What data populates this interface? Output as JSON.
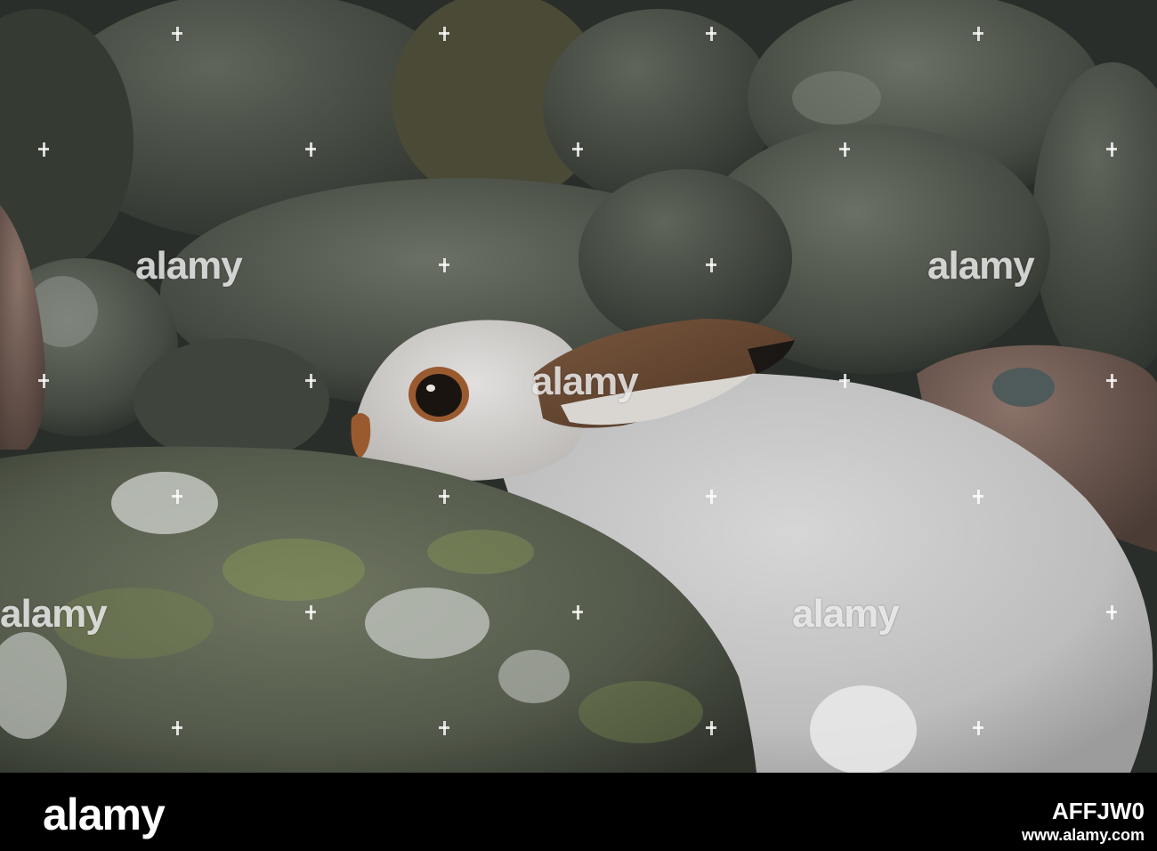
{
  "watermark": {
    "text": "alamy"
  },
  "footer": {
    "logo": "alamy",
    "image_id": "AFFJW0",
    "url": "www.alamy.com"
  },
  "colors": {
    "rock": "#5d6258",
    "lichen": "#8a9a55",
    "fur": "#c9c9c9",
    "ear": "#6b4a33"
  }
}
